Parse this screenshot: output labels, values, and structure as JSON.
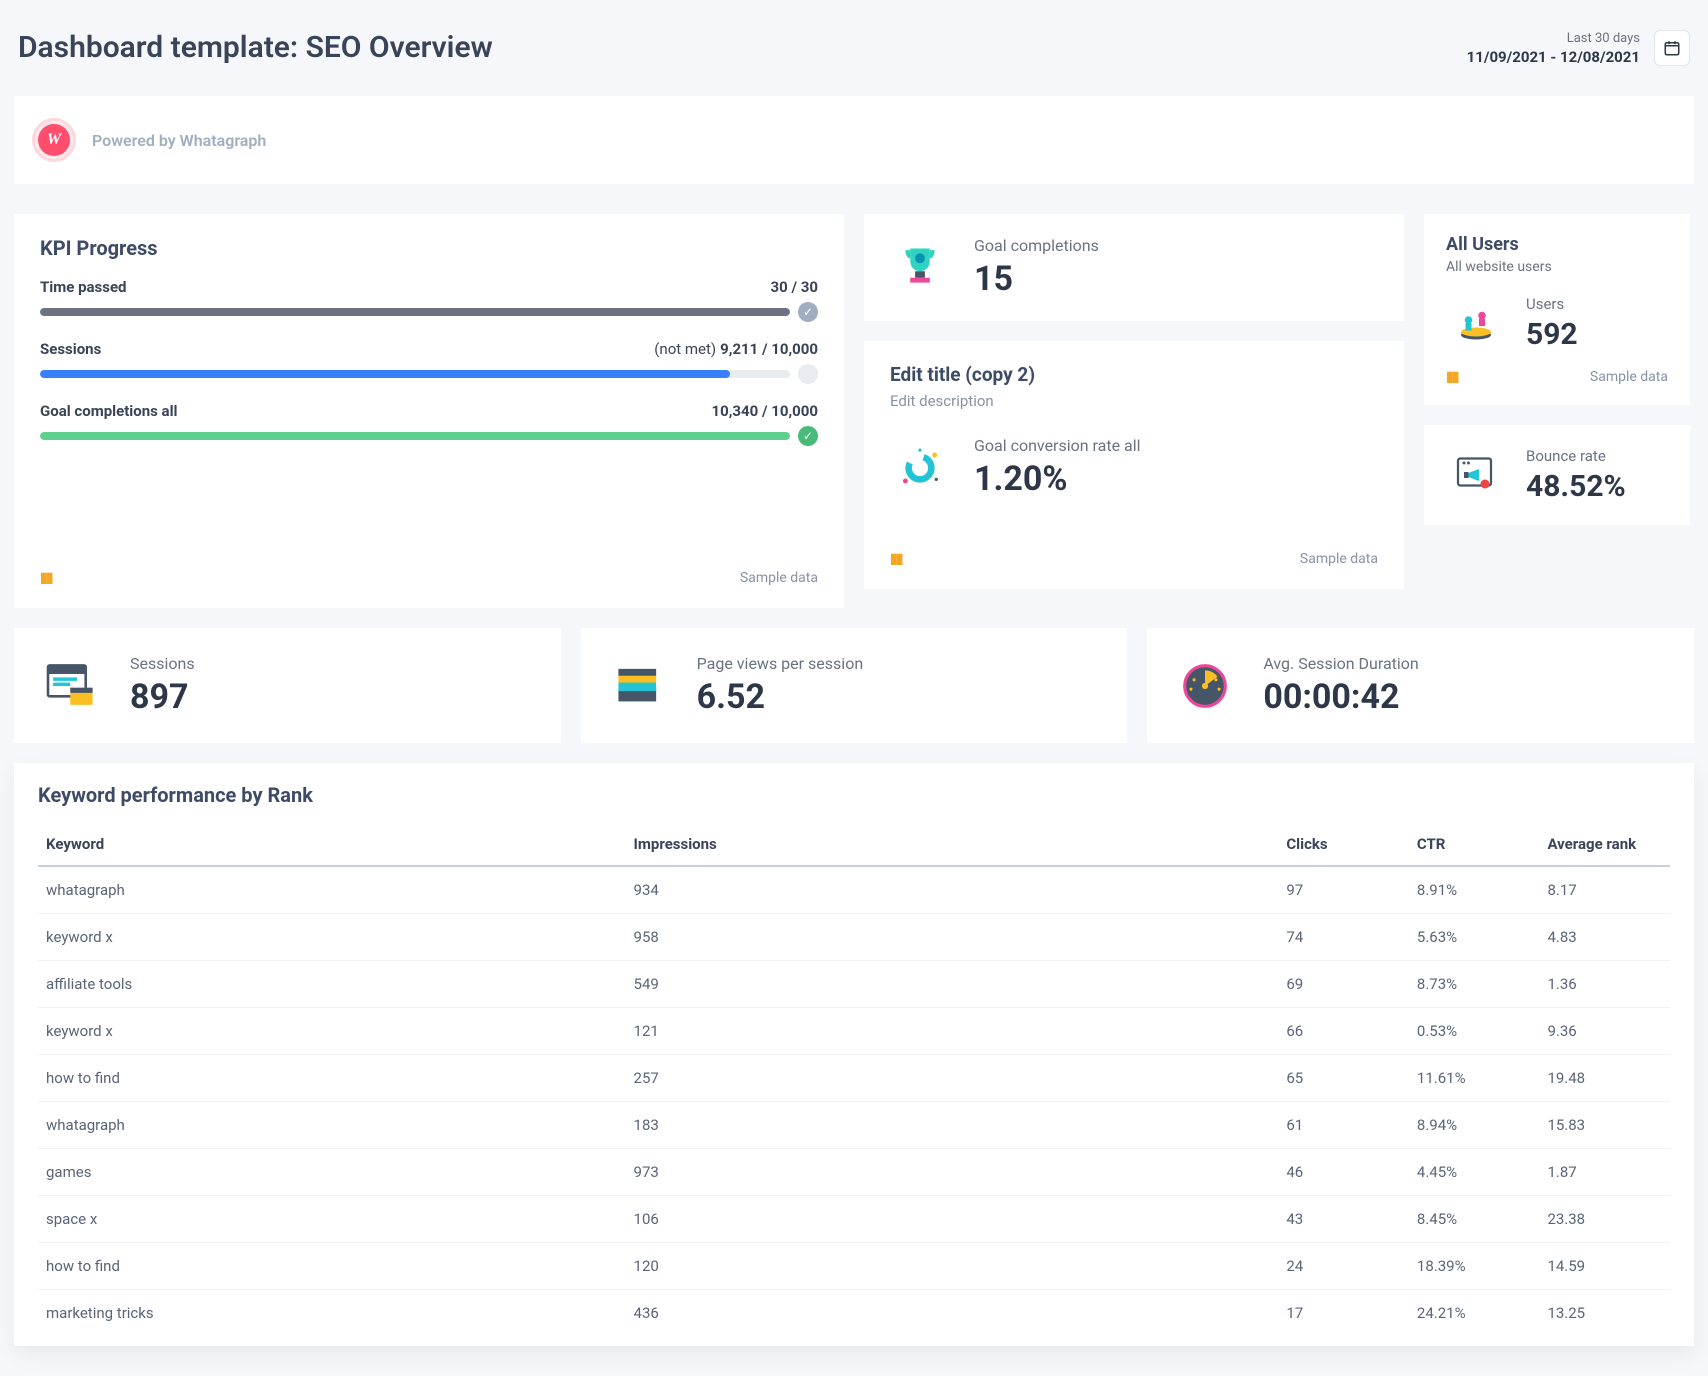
{
  "header": {
    "title": "Dashboard template: SEO Overview",
    "date_label": "Last 30 days",
    "date_range": "11/09/2021 - 12/08/2021"
  },
  "branding": {
    "text": "Powered by Whatagraph",
    "logo_letter": "W"
  },
  "kpi": {
    "title": "KPI Progress",
    "sample": "Sample data",
    "rows": [
      {
        "label": "Time passed",
        "value": "30 / 30",
        "prefix": "",
        "pct": 100,
        "color": "bar-gray",
        "dot": "dot-gray",
        "check": true
      },
      {
        "label": "Sessions",
        "value": "9,211 / 10,000",
        "prefix": "(not met)",
        "pct": 92,
        "color": "bar-blue",
        "dot": "dot-empty",
        "check": false
      },
      {
        "label": "Goal completions all",
        "value": "10,340 / 10,000",
        "prefix": "",
        "pct": 100,
        "color": "bar-green",
        "dot": "dot-green",
        "check": true
      }
    ]
  },
  "goal_completions": {
    "label": "Goal completions",
    "value": "15"
  },
  "edit_widget": {
    "title": "Edit title (copy 2)",
    "desc": "Edit description",
    "stat_label": "Goal conversion rate all",
    "stat_value": "1.20%",
    "sample": "Sample data"
  },
  "all_users": {
    "title": "All Users",
    "sub": "All website users",
    "stat_label": "Users",
    "stat_value": "592",
    "sample": "Sample data"
  },
  "bounce": {
    "label": "Bounce rate",
    "value": "48.52%"
  },
  "row_cards": [
    {
      "label": "Sessions",
      "value": "897"
    },
    {
      "label": "Page views per session",
      "value": "6.52"
    },
    {
      "label": "Avg. Session Duration",
      "value": "00:00:42"
    }
  ],
  "table": {
    "title": "Keyword performance by Rank",
    "columns": [
      "Keyword",
      "Impressions",
      "Clicks",
      "CTR",
      "Average rank"
    ],
    "rows": [
      [
        "whatagraph",
        "934",
        "97",
        "8.91%",
        "8.17"
      ],
      [
        "keyword x",
        "958",
        "74",
        "5.63%",
        "4.83"
      ],
      [
        "affiliate tools",
        "549",
        "69",
        "8.73%",
        "1.36"
      ],
      [
        "keyword x",
        "121",
        "66",
        "0.53%",
        "9.36"
      ],
      [
        "how to find",
        "257",
        "65",
        "11.61%",
        "19.48"
      ],
      [
        "whatagraph",
        "183",
        "61",
        "8.94%",
        "15.83"
      ],
      [
        "games",
        "973",
        "46",
        "4.45%",
        "1.87"
      ],
      [
        "space x",
        "106",
        "43",
        "8.45%",
        "23.38"
      ],
      [
        "how to find",
        "120",
        "24",
        "18.39%",
        "14.59"
      ],
      [
        "marketing tricks",
        "436",
        "17",
        "24.21%",
        "13.25"
      ]
    ]
  }
}
